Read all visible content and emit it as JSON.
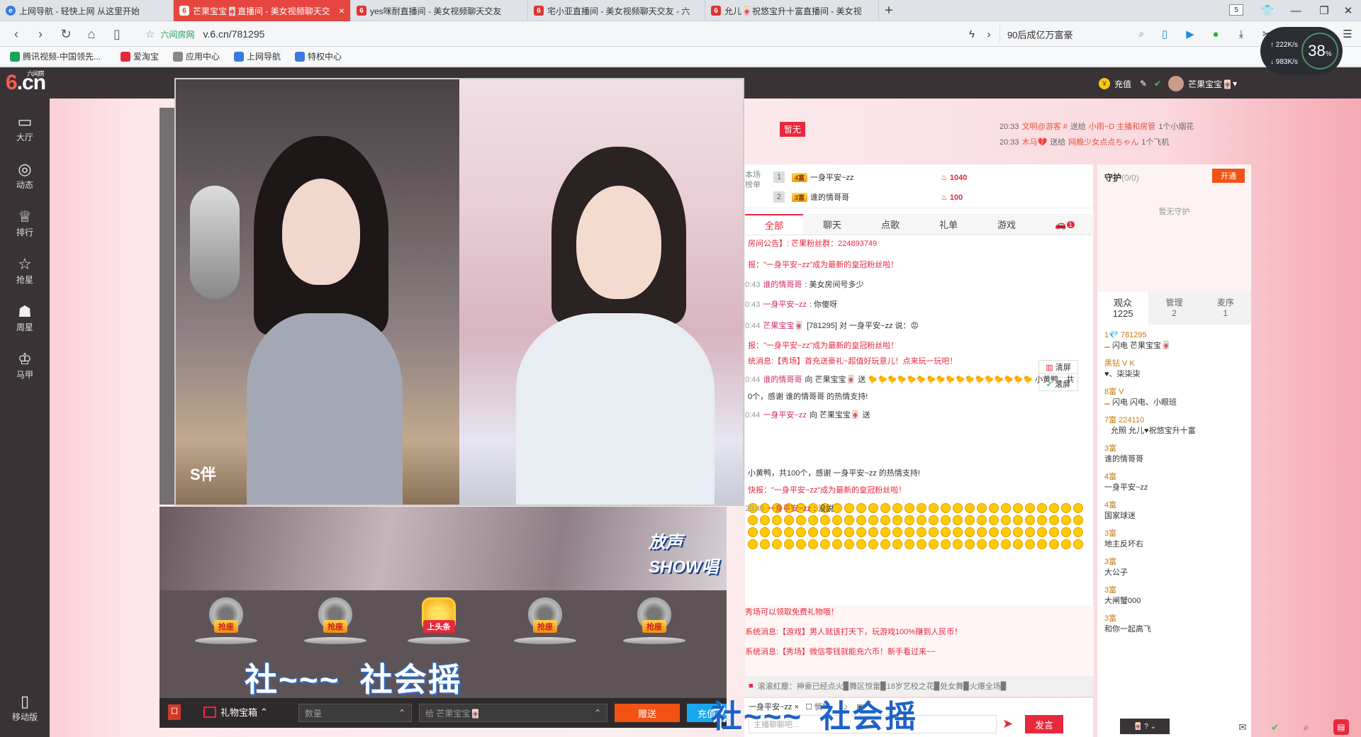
{
  "browser": {
    "tabs": [
      {
        "title": "上网导航 - 轻快上网 从这里开始",
        "icon": "ie",
        "active": false
      },
      {
        "title": "芒果宝宝🀄直播间 - 美女视频聊天交",
        "icon": "six",
        "active": true
      },
      {
        "title": "yes咪耐直播间 - 美女视频聊天交友",
        "icon": "six",
        "active": false
      },
      {
        "title": "宅小亚直播间 - 美女视频聊天交友 - 六",
        "icon": "six",
        "active": false
      },
      {
        "title": "允儿🀄祝悠宝升十富直播间 - 美女视",
        "icon": "six",
        "active": false
      }
    ],
    "tab_count": "5",
    "close_glyph": "×",
    "new_tab": "+",
    "url_site": "六间房网",
    "url": "v.6.cn/781295",
    "search_text": "90后成亿万富豪",
    "bookmarks": [
      "腾讯视频-中国领先...",
      "爱淘宝",
      "应用中心",
      "上网导航",
      "特权中心"
    ],
    "speed": {
      "up": "222K/s",
      "down": "983K/s",
      "pct": "38",
      "unit": "%"
    }
  },
  "site": {
    "logo_six": "6",
    "logo_cn": ".cn",
    "logo_brand": "六间房",
    "charge": "充值",
    "username": "芒果宝宝🀄",
    "sidebar": [
      {
        "label": "大厅",
        "icon": "▭"
      },
      {
        "label": "动态",
        "icon": "◎"
      },
      {
        "label": "排行",
        "icon": "♕"
      },
      {
        "label": "抢星",
        "icon": "☆"
      },
      {
        "label": "周星",
        "icon": "☗"
      },
      {
        "label": "马甲",
        "icon": "♔"
      }
    ],
    "mobile": "移动版"
  },
  "stage": {
    "seats": [
      "抢座",
      "抢座",
      "上头条",
      "抢座",
      "抢座"
    ],
    "shake_a": "社~~~",
    "shake_b": "社会摇",
    "tagline": "放声SHOW唱",
    "cam_caption": "S伴"
  },
  "giftbar": {
    "box": "礼物宝箱",
    "qty_placeholder": "数量",
    "to": "给 芒果宝宝🀄",
    "send": "赠送",
    "charge": "充值"
  },
  "gift_top": {
    "flag": "暂无",
    "lines": [
      {
        "time": "20:33",
        "from": "文明@游客 #",
        "act": "送给",
        "to": "小雨~D 主播和房管",
        "gift": "1个小烟花"
      },
      {
        "time": "20:33",
        "from": "木马💔",
        "act": "送给",
        "to": "网瘾少女点点ちゃん",
        "gift": "1个飞机"
      }
    ]
  },
  "rank": {
    "label": "本场榜单",
    "rows": [
      {
        "n": "1",
        "level": "4富",
        "name": "一身平安~zz",
        "score": "1040"
      },
      {
        "n": "2",
        "level": "3富",
        "name": "谁的情哥哥",
        "score": "100"
      }
    ]
  },
  "chat_tabs": [
    "全部",
    "聊天",
    "点歌",
    "礼单",
    "游戏"
  ],
  "chat_badge": "1",
  "tools": {
    "clear": "清屏",
    "scroll": "滚屏"
  },
  "messages": [
    {
      "time": "",
      "user": "",
      "text": "房间公告】: 芒果粉丝群：224893749",
      "cls": "red"
    },
    {
      "time": "",
      "user": "",
      "text": "报：\"一身平安~zz\"成为最新的皇冠粉丝啦！",
      "cls": "red"
    },
    {
      "time": "0:43",
      "user": "谁的情哥哥",
      "text": ": 美女房间号多少",
      "cls": ""
    },
    {
      "time": "0:43",
      "user": "一身平安~zz",
      "text": ": 你傻呀",
      "cls": ""
    },
    {
      "time": "0:44",
      "user": "芒果宝宝🀄",
      "text": "[781295] 对 一身平安~zz 说：😡",
      "cls": ""
    },
    {
      "time": "",
      "user": "",
      "text": "报：\"一身平安~zz\"成为最新的皇冠粉丝啦！",
      "cls": "red"
    },
    {
      "time": "",
      "user": "",
      "text": "统消息:【秀场】首充送豪礼~超值好玩意儿！点来玩一玩吧！",
      "cls": "red"
    },
    {
      "time": "0:44",
      "user": "谁的情哥哥",
      "text": "向 芒果宝宝🀄 送 🐤🐤🐤🐤🐤🐤🐤🐤🐤🐤🐤🐤🐤🐤🐤🐤🐤 小黄鸭，共",
      "cls": ""
    },
    {
      "time": "",
      "user": "",
      "text": "0个，感谢 谁的情哥哥 的热情支持!",
      "cls": ""
    },
    {
      "time": "0:44",
      "user": "一身平安~zz",
      "text": "向 芒果宝宝🀄 送",
      "cls": ""
    },
    {
      "time": "",
      "user": "",
      "text": "小黄鸭，共100个，感谢 一身平安~zz 的热情支持!",
      "cls": ""
    },
    {
      "time": "",
      "user": "",
      "text": "快报：\"一身平安~zz\"成为最新的皇冠粉丝啦！",
      "cls": "red"
    },
    {
      "time": "20:45",
      "user": "一身平安~zz",
      "text": ": 没説",
      "cls": ""
    }
  ],
  "system": [
    "秀场可以领取免费礼物哦！",
    "系统消息:【游戏】男人就该打天下，玩游戏100%赚到人民币！",
    "系统消息:【秀场】微信零钱就能充六币！新手看过来~~"
  ],
  "marquee": "滚滚紅塵：神豪已经点火▉舞区惊雷▉18岁艺校之花▉处女舞▉火爆全场▉",
  "compose": {
    "to": "一身平安~zz ×",
    "private": "悄悄",
    "placeholder": "主播聊聊吧...",
    "post": "发言"
  },
  "overlay": {
    "a": "社~~~",
    "b": "社会摇"
  },
  "guard": {
    "title": "守护",
    "count": "(0/0)",
    "open": "开通",
    "none": "暂无守护"
  },
  "audience_tabs": [
    {
      "label": "观众",
      "count": "1225"
    },
    {
      "label": "管理",
      "count": "2"
    },
    {
      "label": "麦序",
      "count": "1"
    }
  ],
  "audience": [
    {
      "l1": "1💎 781295",
      "l2": "闪电 芒果宝宝🀄",
      "tag": "blue"
    },
    {
      "l1": "黑钻 V K",
      "l2": "♥、柒柒柒",
      "tag": ""
    },
    {
      "l1": "8富 V",
      "l2": "闪电 闪电、小眼班",
      "tag": "blue"
    },
    {
      "l1": "7富 224110",
      "l2": "允照 允儿♥祝悠宝升十富",
      "tag": "red"
    },
    {
      "l1": "3富",
      "l2": "谁的情哥哥",
      "tag": ""
    },
    {
      "l1": "4富",
      "l2": "一身平安~zz",
      "tag": ""
    },
    {
      "l1": "4富",
      "l2": "国家球迷",
      "tag": ""
    },
    {
      "l1": "3富",
      "l2": "地主反坏右",
      "tag": ""
    },
    {
      "l1": "3富",
      "l2": "大公子",
      "tag": ""
    },
    {
      "l1": "3富",
      "l2": "大闸蟹000",
      "tag": ""
    },
    {
      "l1": "3富",
      "l2": "和你一起高飞",
      "tag": ""
    }
  ],
  "mini_bar": "🀄 ? ⌄",
  "colors": {
    "accent": "#e8283d",
    "topbar": "#3a3335",
    "send": "#f25315",
    "charge": "#17a7ec"
  }
}
